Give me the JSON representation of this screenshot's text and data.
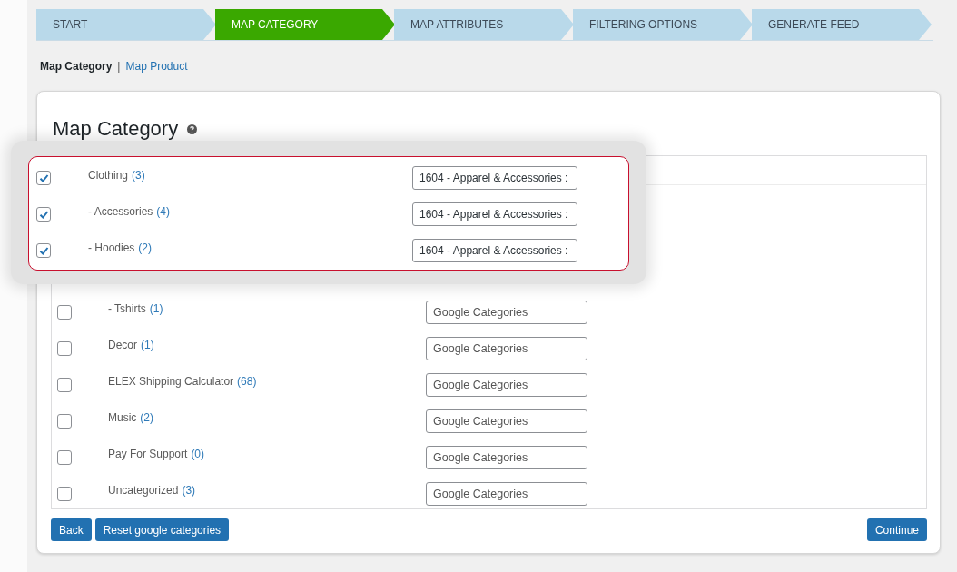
{
  "steps": [
    {
      "label": "START",
      "selected": false
    },
    {
      "label": "MAP CATEGORY",
      "selected": true
    },
    {
      "label": "MAP ATTRIBUTES",
      "selected": false
    },
    {
      "label": "FILTERING OPTIONS",
      "selected": false
    },
    {
      "label": "GENERATE FEED",
      "selected": false
    }
  ],
  "subnav": [
    {
      "label": "Map Category",
      "selected": true
    },
    {
      "label": "Map Product",
      "selected": false
    }
  ],
  "subnav_separator": "|",
  "title": "Map Category",
  "highlighted_rows": [
    {
      "name": "Clothing",
      "count": "(3)",
      "checked": true,
      "value": "1604 - Apparel & Accessories :"
    },
    {
      "name": "- Accessories",
      "count": "(4)",
      "checked": true,
      "value": "1604 - Apparel & Accessories :"
    },
    {
      "name": "- Hoodies",
      "count": "(2)",
      "checked": true,
      "value": "1604 - Apparel & Accessories :"
    }
  ],
  "rows": [
    {
      "name": "- Tshirts",
      "count": "(1)",
      "checked": false,
      "placeholder": "Google Categories"
    },
    {
      "name": "Decor",
      "count": "(1)",
      "checked": false,
      "placeholder": "Google Categories"
    },
    {
      "name": "ELEX Shipping Calculator",
      "count": "(68)",
      "checked": false,
      "placeholder": "Google Categories"
    },
    {
      "name": "Music",
      "count": "(2)",
      "checked": false,
      "placeholder": "Google Categories"
    },
    {
      "name": "Pay For Support",
      "count": "(0)",
      "checked": false,
      "placeholder": "Google Categories"
    },
    {
      "name": "Uncategorized",
      "count": "(3)",
      "checked": false,
      "placeholder": "Google Categories"
    }
  ],
  "buttons_left": [
    "Back",
    "Reset google categories"
  ],
  "button_right": "Continue"
}
